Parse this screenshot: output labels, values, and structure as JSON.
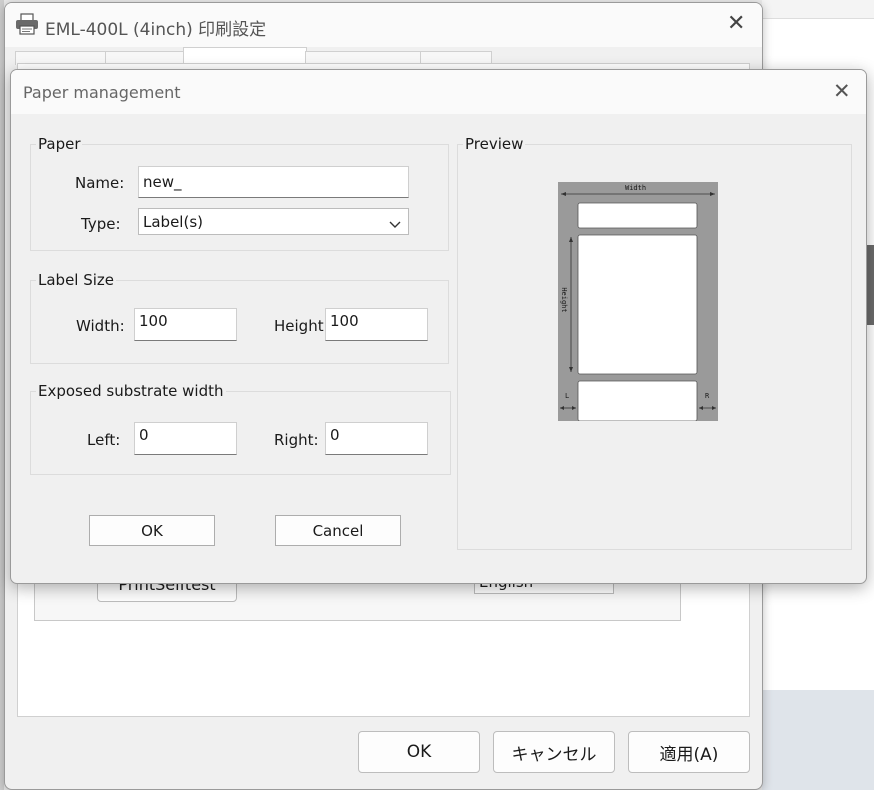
{
  "parent_window": {
    "title": "EML-400L (4inch) 印刷設定",
    "behind_button_label": "PrintSelftest",
    "behind_language_value": "English",
    "buttons": {
      "ok": "OK",
      "cancel": "キャンセル",
      "apply": "適用(A)"
    }
  },
  "dialog": {
    "title": "Paper management",
    "paper_group": {
      "legend": "Paper",
      "name_label": "Name:",
      "name_value": "new_",
      "type_label": "Type:",
      "type_value": "Label(s)"
    },
    "label_size_group": {
      "legend": "Label Size",
      "width_label": "Width:",
      "width_value": "100",
      "height_label": "Height",
      "height_value": "100"
    },
    "substrate_group": {
      "legend": "Exposed substrate width",
      "left_label": "Left:",
      "left_value": "0",
      "right_label": "Right:",
      "right_value": "0"
    },
    "buttons": {
      "ok": "OK",
      "cancel": "Cancel"
    },
    "preview": {
      "legend": "Preview",
      "width_text": "Width",
      "height_text": "Height",
      "left_text": "L",
      "right_text": "R"
    }
  }
}
